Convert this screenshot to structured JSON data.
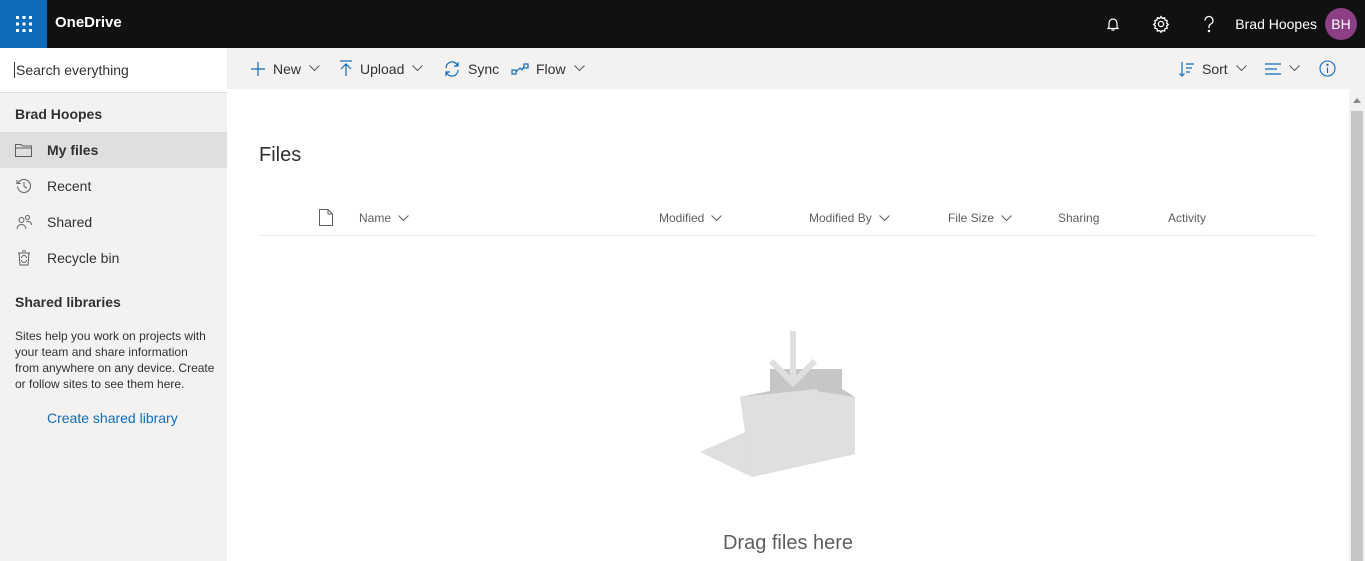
{
  "topbar": {
    "app_title": "OneDrive",
    "user_name": "Brad Hoopes",
    "avatar_initials": "BH",
    "icons": [
      "app-launcher-icon",
      "bell-icon",
      "gear-icon",
      "help-icon"
    ],
    "colors": {
      "bar": "#111111",
      "launcher": "#0f6cbd",
      "avatar": "#8d3f86"
    }
  },
  "search": {
    "placeholder": "Search everything"
  },
  "sidebar": {
    "user_header": "Brad Hoopes",
    "items": [
      {
        "label": "My files",
        "icon": "folder-icon",
        "selected": true
      },
      {
        "label": "Recent",
        "icon": "history-icon",
        "selected": false
      },
      {
        "label": "Shared",
        "icon": "people-icon",
        "selected": false
      },
      {
        "label": "Recycle bin",
        "icon": "recycle-bin-icon",
        "selected": false
      }
    ],
    "shared_libraries_header": "Shared libraries",
    "shared_libraries_help": "Sites help you work on projects with your team and share information from anywhere on any device. Create or follow sites to see them here.",
    "create_link": "Create shared library"
  },
  "commandbar": {
    "new_label": "New",
    "upload_label": "Upload",
    "sync_label": "Sync",
    "flow_label": "Flow",
    "sort_label": "Sort"
  },
  "main": {
    "title": "Files",
    "columns": [
      "Name",
      "Modified",
      "Modified By",
      "File Size",
      "Sharing",
      "Activity"
    ],
    "empty_text": "Drag files here"
  }
}
